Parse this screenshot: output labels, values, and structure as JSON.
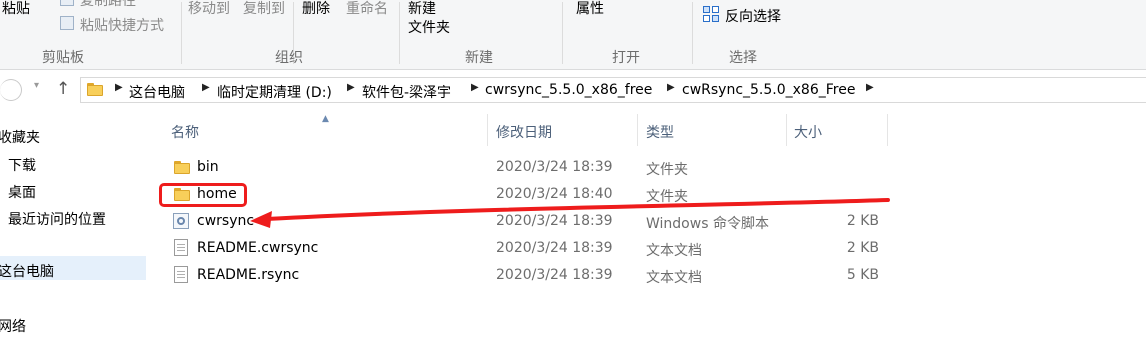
{
  "ribbon": {
    "clipboard": {
      "paste": "粘贴",
      "copy_path": "复制路径",
      "paste_shortcut": "粘贴快捷方式",
      "group": "剪贴板"
    },
    "organize": {
      "move_to": "移动到",
      "copy_to": "复制到",
      "delete": "删除",
      "rename": "重命名",
      "group": "组织"
    },
    "new": {
      "new_folder_line1": "新建",
      "new_folder_line2": "文件夹",
      "group": "新建"
    },
    "open": {
      "properties": "属性",
      "group": "打开"
    },
    "select": {
      "invert_selection": "反向选择",
      "group": "选择"
    }
  },
  "address_bar": {
    "breadcrumbs": [
      "这台电脑",
      "临时定期清理 (D:)",
      "软件包-梁泽宇",
      "cwrsync_5.5.0_x86_free",
      "cwRsync_5.5.0_x86_Free"
    ]
  },
  "navigation": {
    "quick_access": "收藏夹",
    "downloads": "下载",
    "desktop": "桌面",
    "recent": "最近访问的位置",
    "this_pc": "这台电脑",
    "network": "网络"
  },
  "file_list": {
    "columns": {
      "name": "名称",
      "modified": "修改日期",
      "type": "类型",
      "size": "大小"
    },
    "rows": [
      {
        "name": "bin",
        "modified": "2020/3/24 18:39",
        "type": "文件夹",
        "size": "",
        "icon": "folder-icon"
      },
      {
        "name": "home",
        "modified": "2020/3/24 18:40",
        "type": "文件夹",
        "size": "",
        "icon": "folder-icon"
      },
      {
        "name": "cwrsync",
        "modified": "2020/3/24 18:39",
        "type": "Windows 命令脚本",
        "size": "2 KB",
        "icon": "batch-file-icon"
      },
      {
        "name": "README.cwrsync",
        "modified": "2020/3/24 18:39",
        "type": "文本文档",
        "size": "2 KB",
        "icon": "text-file-icon"
      },
      {
        "name": "README.rsync",
        "modified": "2020/3/24 18:39",
        "type": "文本文档",
        "size": "5 KB",
        "icon": "text-file-icon"
      }
    ]
  },
  "annotation": {
    "color": "#ee1c1c"
  }
}
